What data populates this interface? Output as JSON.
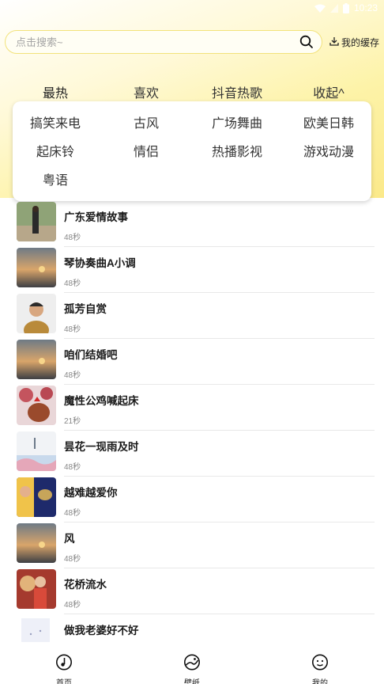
{
  "status_bar": {
    "time": "10:23"
  },
  "search": {
    "placeholder": "点击搜索~",
    "cache_label": "我的缓存"
  },
  "tabs": [
    "最热",
    "喜欢",
    "抖音热歌",
    "收起^"
  ],
  "categories": [
    "搞笑来电",
    "古风",
    "广场舞曲",
    "欧美日韩",
    "起床铃",
    "情侣",
    "热播影视",
    "游戏动漫",
    "粤语"
  ],
  "songs": [
    {
      "title": "广东爱情故事",
      "duration": "48秒"
    },
    {
      "title": "琴协奏曲A小调",
      "duration": "48秒"
    },
    {
      "title": "孤芳自赏",
      "duration": "48秒"
    },
    {
      "title": "咱们结婚吧",
      "duration": "48秒"
    },
    {
      "title": "魔性公鸡喊起床",
      "duration": "21秒"
    },
    {
      "title": "昙花一现雨及时",
      "duration": "48秒"
    },
    {
      "title": "越难越爱你",
      "duration": "48秒"
    },
    {
      "title": "风",
      "duration": "48秒"
    },
    {
      "title": "花桥流水",
      "duration": "48秒"
    },
    {
      "title": "做我老婆好不好",
      "duration": ""
    }
  ],
  "nav": [
    {
      "label": "首页",
      "icon": "music-note-icon"
    },
    {
      "label": "壁纸",
      "icon": "wallpaper-icon"
    },
    {
      "label": "我的",
      "icon": "profile-smile-icon"
    }
  ],
  "colors": {
    "accent": "#fbe98a",
    "indicator": "#8bd33a",
    "search_border": "#f2e27a"
  }
}
